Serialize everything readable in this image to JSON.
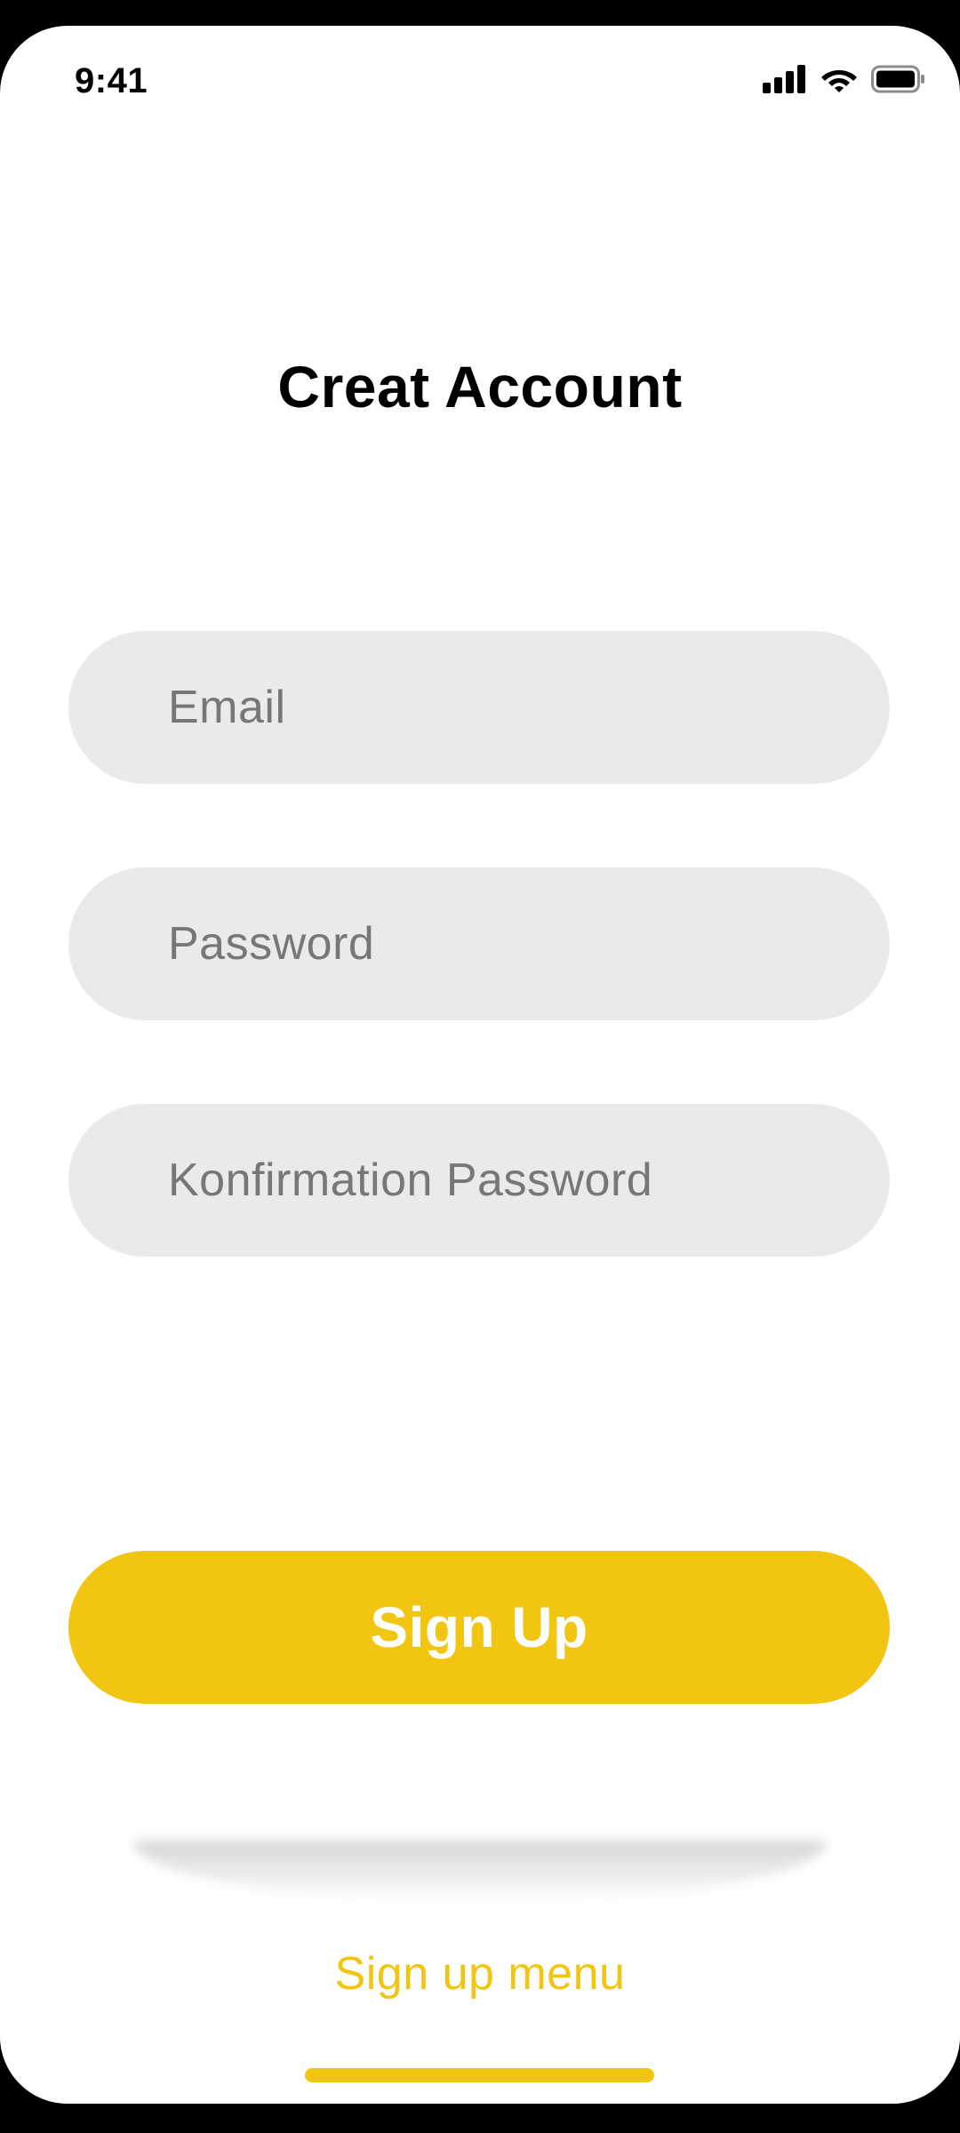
{
  "status_bar": {
    "time": "9:41",
    "icons": [
      "signal-icon",
      "wifi-icon",
      "battery-icon"
    ]
  },
  "page": {
    "title": "Creat Account"
  },
  "form": {
    "email_placeholder": "Email",
    "password_placeholder": "Password",
    "confirm_placeholder": "Konfirmation Password"
  },
  "actions": {
    "signup_label": "Sign Up",
    "signup_menu_label": "Sign up menu"
  },
  "colors": {
    "accent": "#F1C512",
    "field_background": "#EAEAEA",
    "placeholder_text": "#777777",
    "title_text": "#000000",
    "background": "#FFFFFF"
  }
}
